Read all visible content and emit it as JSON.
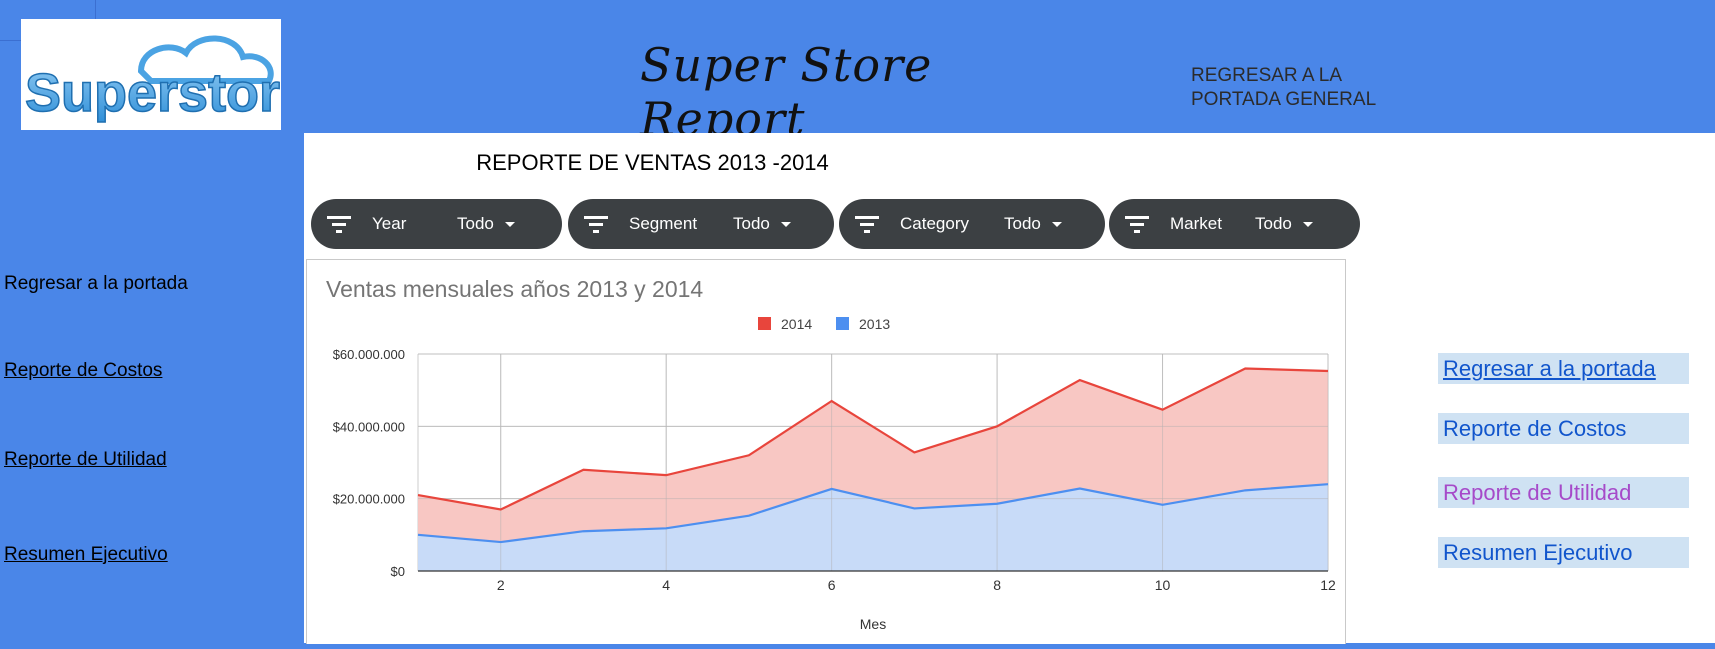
{
  "header": {
    "title": "Super Store Report",
    "back_general_line1": "REGRESAR A LA",
    "back_general_line2": "PORTADA GENERAL",
    "logo_text": "Superstore"
  },
  "report": {
    "title": "REPORTE DE VENTAS 2013 -2014"
  },
  "filters": [
    {
      "label": "Year",
      "value": "Todo"
    },
    {
      "label": "Segment",
      "value": "Todo"
    },
    {
      "label": "Category",
      "value": "Todo"
    },
    {
      "label": "Market",
      "value": "Todo"
    }
  ],
  "left_nav": [
    {
      "label": "Regresar a la portada"
    },
    {
      "label": "Reporte de Costos"
    },
    {
      "label": "Reporte de  Utilidad"
    },
    {
      "label": "Resumen Ejecutivo"
    }
  ],
  "right_nav": [
    {
      "label": "Regresar a la portada"
    },
    {
      "label": "Reporte de Costos"
    },
    {
      "label": "Reporte de  Utilidad"
    },
    {
      "label": "Resumen Ejecutivo"
    }
  ],
  "colors": {
    "background": "#4a86e8",
    "series_2014": "#e8453c",
    "series_2014_fill": "#f8c4c0",
    "series_2013": "#4d8ff0",
    "series_2013_fill": "#c5d9f8",
    "right_link_visited": "#a64ac9",
    "right_link": "#1155cc"
  },
  "chart_data": {
    "type": "area",
    "title": "Ventas mensuales años 2013 y 2014",
    "xlabel": "Mes",
    "ylabel": "",
    "x": [
      1,
      2,
      3,
      4,
      5,
      6,
      7,
      8,
      9,
      10,
      11,
      12
    ],
    "x_ticks": [
      2,
      4,
      6,
      8,
      10,
      12
    ],
    "y_ticks": [
      "$0",
      "$20.000.000",
      "$40.000.000",
      "$60.000.000"
    ],
    "y_tick_values": [
      0,
      20000000,
      40000000,
      60000000
    ],
    "ylim": [
      0,
      60000000
    ],
    "legend_position": "top",
    "grid": true,
    "series": [
      {
        "name": "2014",
        "values": [
          21000000,
          17000000,
          28000000,
          26500000,
          32000000,
          47000000,
          32800000,
          40000000,
          52800000,
          44600000,
          56000000,
          55300000
        ]
      },
      {
        "name": "2013",
        "values": [
          10000000,
          8000000,
          11000000,
          11800000,
          15300000,
          22700000,
          17300000,
          18600000,
          22800000,
          18300000,
          22300000,
          24000000
        ]
      }
    ]
  }
}
